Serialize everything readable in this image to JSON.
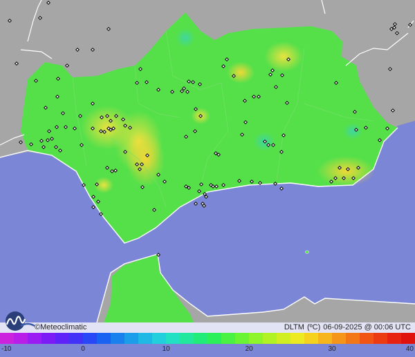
{
  "map": {
    "colors": {
      "sea": "#7b86d6",
      "land_outside": "#a6a6a6",
      "region_fill": "#55e04a",
      "warm_spot": "#c9e23c",
      "hot_spot": "#e7e040",
      "cool_spot": "#3fd98a",
      "border": "#ffffff",
      "station": "#111111"
    }
  },
  "brand": {
    "copyright": "©",
    "name": "Meteoclimatic",
    "logo_icon": "meteoclimatic-logo-icon"
  },
  "info": {
    "variable": "DLTM",
    "unit": "(ºC)",
    "timestamp": "06-09-2025 @ 00:06 UTC"
  },
  "scale": {
    "min": -10,
    "max": 40,
    "ticks": [
      "-10",
      "0",
      "10",
      "20",
      "30",
      "40"
    ],
    "colors": [
      "#cc22dd",
      "#b81ee8",
      "#9a1cf2",
      "#7d1bf6",
      "#5f22f8",
      "#4232f8",
      "#2847f6",
      "#1a62f2",
      "#1a80ee",
      "#1c9dea",
      "#20b9e6",
      "#22cfdd",
      "#22e0c4",
      "#22e89e",
      "#22ec79",
      "#2cf05a",
      "#49f243",
      "#6af534",
      "#8ef52a",
      "#b1f225",
      "#d1ee22",
      "#ecea20",
      "#f5d21e",
      "#f6b51c",
      "#f5961a",
      "#f37617",
      "#f05514",
      "#ec3a12",
      "#e82210",
      "#e0120e"
    ]
  }
}
